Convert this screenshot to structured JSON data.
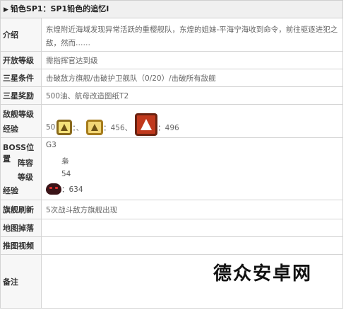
{
  "title": {
    "arrow": "▶",
    "text": "铅色SP1：SP1铅色的追忆I"
  },
  "rows": {
    "intro": {
      "label": "介绍",
      "value": "东煌附近海域发现异常活跃的重樱舰队，东煌的姐妹-平海宁海收到命令，前往驱逐进犯之敌，然而……"
    },
    "unlock": {
      "label": "开放等级",
      "value": "需指挥官达到级"
    },
    "star_cond": {
      "label": "三星条件",
      "value": "击破敌方旗舰/击破护卫舰队（0/20）/击破所有敌舰"
    },
    "star_reward": {
      "label": "三星奖励",
      "value": "500油、航母改造图纸T2"
    },
    "enemy": {
      "label1": "敌舰等级",
      "label2": "经验",
      "level": "50",
      "sep1": "：、",
      "exp2": "：456、",
      "exp3": "：496"
    },
    "boss": {
      "label1": "BOSS位置",
      "label2": "阵容",
      "label3": "等级",
      "label4": "经验",
      "position": "G3",
      "lineup": "枭",
      "level": "54",
      "exp": "：634"
    },
    "flagship": {
      "label": "旗舰刷新",
      "value": "5次战斗敌方旗舰出现"
    },
    "drops": {
      "label": "地图掉落",
      "value": ""
    },
    "video": {
      "label": "推图视频",
      "value": ""
    },
    "notes": {
      "label": "备注",
      "value": ""
    }
  },
  "watermark": "德众安卓网",
  "icons": {
    "badge_small": "ship-badge-a-icon",
    "badge_medium": "ship-badge-b-icon",
    "badge_large": "ship-badge-c-icon",
    "boss": "boss-head-icon"
  },
  "colors": {
    "label_bg": "#f7f7f7",
    "border": "#d4d4d4",
    "badge_red": "#c0391d",
    "badge_gold": "#f2d675"
  }
}
